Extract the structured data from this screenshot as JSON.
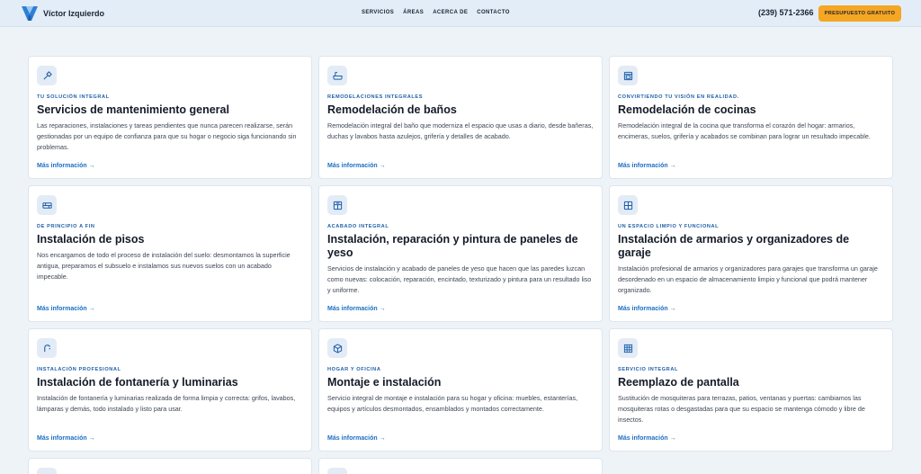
{
  "header": {
    "brand": "Víctor Izquierdo",
    "nav": [
      "SERVICIOS",
      "ÁREAS",
      "ACERCA DE",
      "CONTACTO"
    ],
    "phone": "(239) 571-2366",
    "cta": "PRESUPUESTO GRATUITO"
  },
  "cards": [
    {
      "eyebrow": "TU SOLUCIÓN INTEGRAL",
      "title": "Servicios de mantenimiento general",
      "desc": "Las reparaciones, instalaciones y tareas pendientes que nunca parecen realizarse, serán gestionadas por un equipo de confianza para que su hogar o negocio siga funcionando sin problemas.",
      "link": "Más información →",
      "icon": "hammer-icon"
    },
    {
      "eyebrow": "REMODELACIONES INTEGRALES",
      "title": "Remodelación de baños",
      "desc": "Remodelación integral del baño que moderniza el espacio que usas a diario, desde bañeras, duchas y lavabos hasta azulejos, grifería y detalles de acabado.",
      "link": "Más información →",
      "icon": "bathtub-icon"
    },
    {
      "eyebrow": "CONVIRTIENDO TU VISIÓN EN REALIDAD.",
      "title": "Remodelación de cocinas",
      "desc": "Remodelación integral de la cocina que transforma el corazón del hogar: armarios, encimeras, suelos, grifería y acabados se combinan para lograr un resultado impecable.",
      "link": "Más información →",
      "icon": "oven-icon"
    },
    {
      "eyebrow": "DE PRINCIPIO A FIN",
      "title": "Instalación de pisos",
      "desc": "Nos encargamos de todo el proceso de instalación del suelo: desmontamos la superficie antigua, preparamos el subsuelo e instalamos sus nuevos suelos con un acabado impecable.",
      "link": "Más información →",
      "icon": "floor-icon"
    },
    {
      "eyebrow": "ACABADO INTEGRAL",
      "title": "Instalación, reparación y pintura de paneles de yeso",
      "desc": "Servicios de instalación y acabado de paneles de yeso que hacen que las paredes luzcan como nuevas: colocación, reparación, encintado, texturizado y pintura para un resultado liso y uniforme.",
      "link": "Más información →",
      "icon": "drywall-icon"
    },
    {
      "eyebrow": "UN ESPACIO LIMPIO Y FUNCIONAL",
      "title": "Instalación de armarios y organizadores de garaje",
      "desc": "Instalación profesional de armarios y organizadores para garajes que transforma un garaje desordenado en un espacio de almacenamiento limpio y funcional que podrá mantener organizado.",
      "link": "Más información →",
      "icon": "cabinet-icon"
    },
    {
      "eyebrow": "INSTALACIÓN PROFESIONAL",
      "title": "Instalación de fontanería y luminarias",
      "desc": "Instalación de fontanería y luminarias realizada de forma limpia y correcta: grifos, lavabos, lámparas y demás, todo instalado y listo para usar.",
      "link": "Más información →",
      "icon": "faucet-icon"
    },
    {
      "eyebrow": "HOGAR Y OFICINA",
      "title": "Montaje e instalación",
      "desc": "Servicio integral de montaje e instalación para su hogar y oficina: muebles, estanterías, equipos y artículos desmontados, ensamblados y montados correctamente.",
      "link": "Más información →",
      "icon": "box-icon"
    },
    {
      "eyebrow": "SERVICIO INTEGRAL",
      "title": "Reemplazo de pantalla",
      "desc": "Sustitución de mosquiteras para terrazas, patios, ventanas y puertas: cambiamos las mosquiteras rotas o desgastadas para que su espacio se mantenga cómodo y libre de insectos.",
      "link": "Más información →",
      "icon": "screen-icon"
    }
  ]
}
